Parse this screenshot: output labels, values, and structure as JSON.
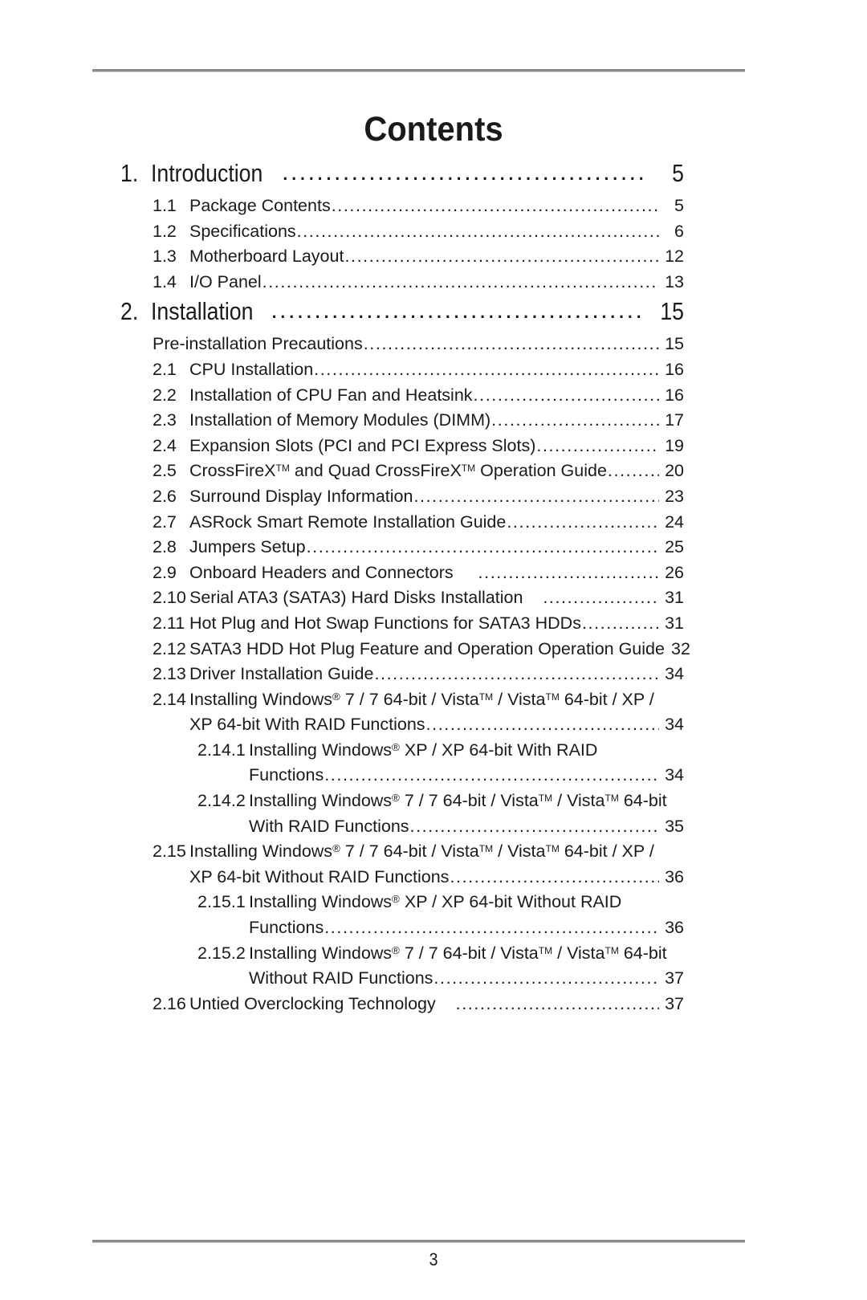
{
  "page": {
    "title": "Contents",
    "folio": "3"
  },
  "toc": [
    {
      "level": "chapter",
      "num": "1.",
      "label": "Introduction",
      "page": "5",
      "leader": true
    },
    {
      "level": "sec",
      "num": "1.1",
      "label": "Package Contents ",
      "page": "5",
      "leader": true
    },
    {
      "level": "sec",
      "num": "1.2",
      "label": "Specifications",
      "page": "6",
      "leader": true
    },
    {
      "level": "sec",
      "num": "1.3",
      "label": "Motherboard Layout ",
      "page": "12",
      "leader": true
    },
    {
      "level": "sec",
      "num": "1.4",
      "label": "I/O Panel  ",
      "page": "13",
      "leader": true
    },
    {
      "level": "chapter",
      "num": "2.",
      "label": "Installation",
      "page": "15",
      "leader": true
    },
    {
      "level": "sec-nonum",
      "num": "",
      "label": "Pre-installation Precautions ",
      "page": "15",
      "leader": true
    },
    {
      "level": "sec",
      "num": "2.1",
      "label": "CPU Installation ",
      "page": "16",
      "leader": true
    },
    {
      "level": "sec",
      "num": "2.2",
      "label": "Installation of CPU Fan and Heatsink  ",
      "page": "16",
      "leader": true
    },
    {
      "level": "sec",
      "num": "2.3",
      "label": "Installation of Memory Modules (DIMM)",
      "page": "17",
      "leader": true
    },
    {
      "level": "sec",
      "num": "2.4",
      "label": "Expansion Slots (PCI and PCI Express Slots)",
      "page": "19",
      "leader": true
    },
    {
      "level": "sec",
      "num": "2.5",
      "label": "CrossFireX<sup>TM</sup> and Quad CrossFireX<sup>TM</sup> Operation Guide",
      "page": "20",
      "leader": true,
      "html": true
    },
    {
      "level": "sec",
      "num": "2.6",
      "label": "Surround Display Information ",
      "page": "23",
      "leader": true
    },
    {
      "level": "sec",
      "num": "2.7",
      "label": "ASRock Smart Remote Installation Guide",
      "page": "24",
      "leader": true
    },
    {
      "level": "sec",
      "num": "2.8",
      "label": "Jumpers Setup",
      "page": "25",
      "leader": true
    },
    {
      "level": "sec",
      "num": "2.9",
      "label": "Onboard Headers and Connectors&nbsp;&nbsp;&nbsp;&nbsp;&nbsp;",
      "page": "26",
      "leader": true,
      "html": true
    },
    {
      "level": "sec",
      "num": "2.10",
      "label": "Serial ATA3 (SATA3) Hard Disks Installation&nbsp;&nbsp;&nbsp;&nbsp;",
      "page": "31",
      "leader": true,
      "html": true
    },
    {
      "level": "sec",
      "num": "2.11",
      "label": "Hot Plug and Hot Swap Functions for SATA3 HDDs ",
      "page": "31",
      "leader": true
    },
    {
      "level": "sec",
      "num": "2.12",
      "label": "SATA3 HDD Hot Plug Feature and Operation Operation Guide",
      "page": "32",
      "leader": false
    },
    {
      "level": "sec",
      "num": "2.13",
      "label": "Driver Installation Guide ",
      "page": "34",
      "leader": true
    },
    {
      "level": "sec",
      "num": "2.14",
      "label": "Installing Windows<sup class=\"reg\">&#174;</sup> 7 / 7 64-bit / Vista<sup>TM</sup> / Vista<sup>TM</sup> 64-bit / XP /",
      "page": "",
      "leader": false,
      "html": true
    },
    {
      "level": "sec-cont",
      "num": "",
      "label": "XP 64-bit With RAID Functions",
      "page": "34",
      "leader": true
    },
    {
      "level": "sub",
      "num": "2.14.1",
      "label": "Installing Windows<sup class=\"reg\">&#174;</sup> XP / XP 64-bit With RAID",
      "page": "",
      "leader": false,
      "html": true
    },
    {
      "level": "sub-cont",
      "num": "",
      "label": "Functions ",
      "page": "34",
      "leader": true
    },
    {
      "level": "sub",
      "num": "2.14.2",
      "label": "Installing Windows<sup class=\"reg\">&#174;</sup> 7 / 7 64-bit / Vista<sup>TM</sup> / Vista<sup>TM</sup> 64-bit",
      "page": "",
      "leader": false,
      "html": true
    },
    {
      "level": "sub-cont",
      "num": "",
      "label": "With RAID Functions ",
      "page": "35",
      "leader": true
    },
    {
      "level": "sec",
      "num": "2.15",
      "label": "Installing Windows<sup class=\"reg\">&#174;</sup> 7 / 7 64-bit / Vista<sup>TM</sup> / Vista<sup>TM</sup> 64-bit / XP /",
      "page": "",
      "leader": false,
      "html": true
    },
    {
      "level": "sec-cont",
      "num": "",
      "label": "XP 64-bit Without RAID Functions",
      "page": "36",
      "leader": true
    },
    {
      "level": "sub",
      "num": "2.15.1",
      "label": "Installing Windows<sup class=\"reg\">&#174;</sup> XP / XP 64-bit Without RAID",
      "page": "",
      "leader": false,
      "html": true
    },
    {
      "level": "sub-cont",
      "num": "",
      "label": "Functions ",
      "page": "36",
      "leader": true
    },
    {
      "level": "sub",
      "num": "2.15.2",
      "label": "Installing Windows<sup class=\"reg\">&#174;</sup> 7 / 7 64-bit / Vista<sup>TM</sup> / Vista<sup>TM</sup> 64-bit",
      "page": "",
      "leader": false,
      "html": true
    },
    {
      "level": "sub-cont",
      "num": "",
      "label": "Without RAID Functions ",
      "page": "37",
      "leader": true
    },
    {
      "level": "sec",
      "num": "2.16",
      "label": "Untied Overclocking Technology&nbsp;&nbsp;&nbsp;&nbsp;",
      "page": "37",
      "leader": true,
      "html": true
    }
  ]
}
